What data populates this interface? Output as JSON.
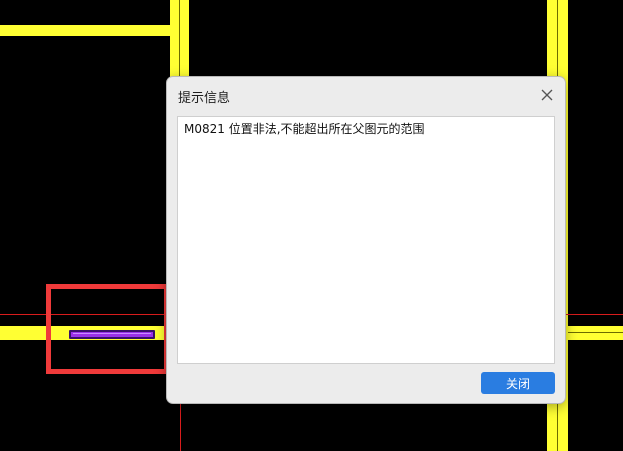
{
  "colors": {
    "background": "#000000",
    "wall": "#ffff33",
    "axis_line": "#d81c1c",
    "highlight": "#f03a3a",
    "door": "#9b30e8",
    "button": "#2a7de1"
  },
  "dialog": {
    "title": "提示信息",
    "close_icon": "close-icon",
    "message": "M0821 位置非法,不能超出所在父图元的范围",
    "close_button_label": "关闭"
  }
}
